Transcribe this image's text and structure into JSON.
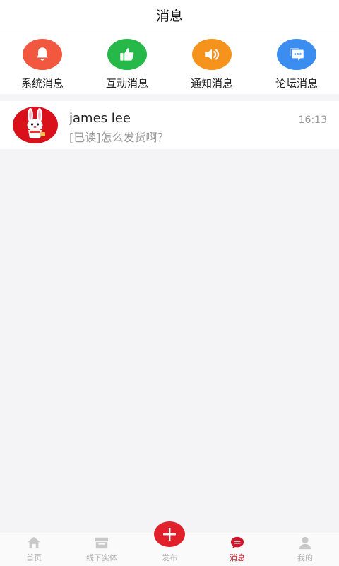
{
  "header": {
    "title": "消息"
  },
  "categories": [
    {
      "label": "系统消息",
      "icon": "bell-icon",
      "color": "#f2583f"
    },
    {
      "label": "互动消息",
      "icon": "thumbs-up-icon",
      "color": "#27b84a"
    },
    {
      "label": "通知消息",
      "icon": "speaker-icon",
      "color": "#f5931d"
    },
    {
      "label": "论坛消息",
      "icon": "chat-bubbles-icon",
      "color": "#3b8ef0"
    }
  ],
  "conversations": [
    {
      "name": "james lee",
      "preview": "[已读]怎么发货啊？",
      "time": "16:13",
      "avatar_icon": "rabbit-avatar"
    }
  ],
  "tabbar": {
    "items": [
      {
        "label": "首页",
        "icon": "home-icon"
      },
      {
        "label": "线下实体",
        "icon": "store-icon"
      },
      {
        "label": "发布",
        "icon": "plus-icon"
      },
      {
        "label": "消息",
        "icon": "message-icon",
        "active": true
      },
      {
        "label": "我的",
        "icon": "user-icon"
      }
    ],
    "active_color": "#d5162a"
  }
}
